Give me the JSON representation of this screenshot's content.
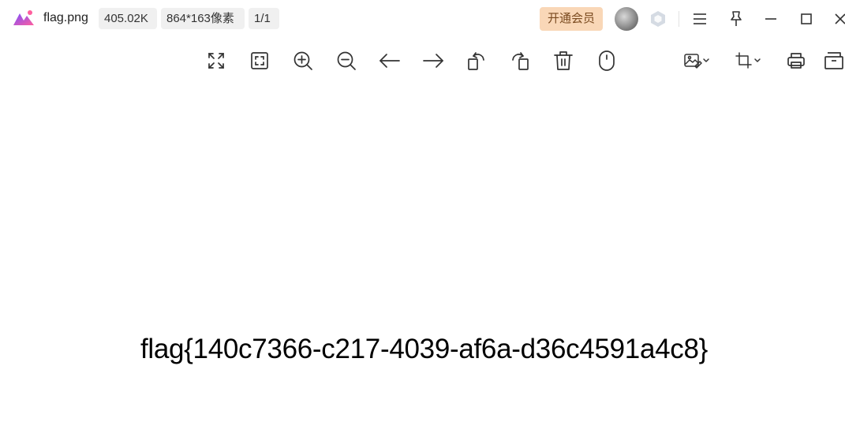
{
  "window": {
    "filename": "flag.png",
    "file_size": "405.02K",
    "dimensions": "864*163像素",
    "page_indicator": "1/1",
    "vip_label": "开通会员"
  },
  "icons": {
    "logo": "app-logo-icon",
    "avatar": "user-avatar",
    "badge": "hexagon-badge-icon",
    "menu": "menu-icon",
    "pin": "pin-icon",
    "minimize": "minimize-icon",
    "maximize": "maximize-icon",
    "close": "close-icon"
  },
  "toolbar": [
    "fullscreen-icon",
    "fit-window-icon",
    "zoom-in-icon",
    "zoom-out-icon",
    "previous-icon",
    "next-icon",
    "rotate-left-icon",
    "rotate-right-icon",
    "delete-icon",
    "mouse-icon",
    "image-edit-icon",
    "crop-icon",
    "print-icon",
    "archive-icon"
  ],
  "image": {
    "text": "flag{140c7366-c217-4039-af6a-d36c4591a4c8}"
  },
  "colors": {
    "vip_bg": "#f9d7b7",
    "vip_text": "#7a4a1f",
    "chip_bg": "#f0f0f0",
    "logo_purple": "#7b4dff",
    "logo_pink": "#ff5f9e"
  }
}
